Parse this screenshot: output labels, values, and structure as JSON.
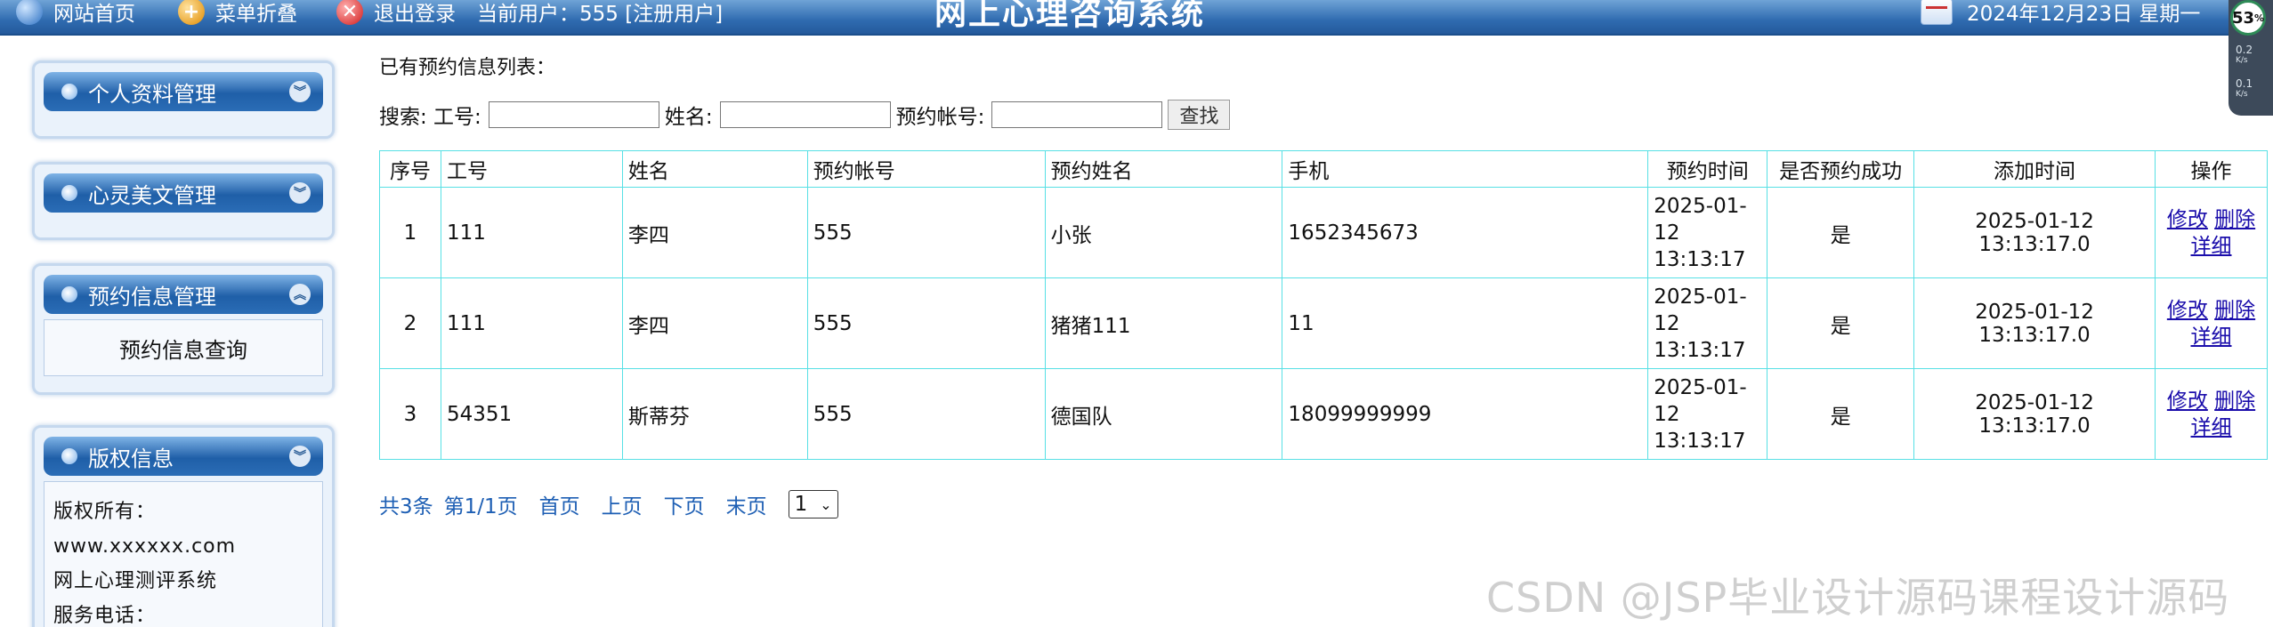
{
  "topbar": {
    "home": "网站首页",
    "fold": "菜单折叠",
    "logout": "退出登录",
    "current_user": "当前用户：555 [注册用户]",
    "title": "网上心理咨询系统",
    "date": "2024年12月23日  星期一",
    "icons": [
      "home-icon",
      "fold-icon",
      "exit-icon",
      "calendar-icon"
    ]
  },
  "widget": {
    "badge": "53",
    "unit": "%",
    "line1": "0.2",
    "line1_unit": "K/s",
    "line2": "0.1",
    "line2_unit": "K/s"
  },
  "sidebar": {
    "profile": "个人资料管理",
    "articles": "心灵美文管理",
    "appointments": "预约信息管理",
    "appointments_query": "预约信息查询",
    "copyright": "版权信息",
    "copy_owner": "版权所有：",
    "copy_site": "www.xxxxxx.com",
    "copy_system": "网上心理测评系统",
    "copy_phone": "服务电话："
  },
  "main": {
    "list_title": "已有预约信息列表：",
    "search_label": "搜索: 工号:",
    "name_label": "姓名:",
    "account_label": "预约帐号:",
    "search_button": "查找",
    "columns": [
      "序号",
      "工号",
      "姓名",
      "预约帐号",
      "预约姓名",
      "手机",
      "预约时间",
      "是否预约成功",
      "添加时间",
      "操作"
    ],
    "rows": [
      {
        "no": "1",
        "job": "111",
        "name": "李四",
        "account": "555",
        "rname": "小张",
        "phone": "1652345673",
        "t1": "2025-01-",
        "t2": "12",
        "t3": "13:13:17",
        "ok": "是",
        "added": "2025-01-12 13:13:17.0"
      },
      {
        "no": "2",
        "job": "111",
        "name": "李四",
        "account": "555",
        "rname": "猪猪111",
        "phone": "11",
        "t1": "2025-01-",
        "t2": "12",
        "t3": "13:13:17",
        "ok": "是",
        "added": "2025-01-12 13:13:17.0"
      },
      {
        "no": "3",
        "job": "54351",
        "name": "斯蒂芬",
        "account": "555",
        "rname": "德国队",
        "phone": "18099999999",
        "t1": "2025-01-",
        "t2": "12",
        "t3": "13:13:17",
        "ok": "是",
        "added": "2025-01-12 13:13:17.0"
      }
    ],
    "op_edit": "修改",
    "op_delete": "删除",
    "op_detail": "详细",
    "pager": {
      "total": "共3条",
      "page": "第1/1页",
      "first": "首页",
      "prev": "上页",
      "next": "下页",
      "last": "末页",
      "select": "1"
    }
  },
  "watermark": "CSDN @JSP毕业设计源码课程设计源码"
}
